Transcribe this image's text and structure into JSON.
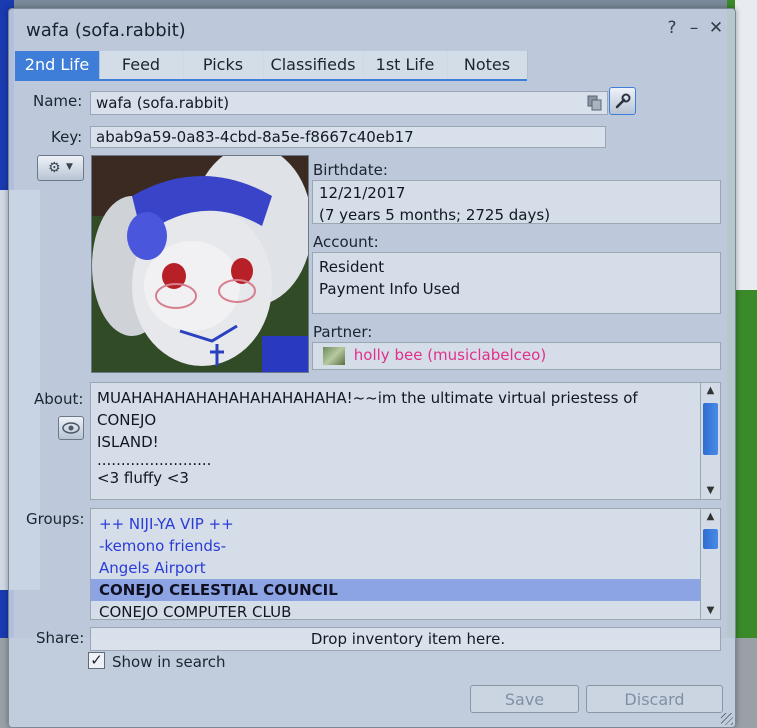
{
  "window": {
    "title": "wafa (sofa.rabbit)",
    "help_glyph": "?",
    "minimize_glyph": "–",
    "close_glyph": "✕"
  },
  "tabs": [
    {
      "label": "2nd Life",
      "active": true
    },
    {
      "label": "Feed"
    },
    {
      "label": "Picks"
    },
    {
      "label": "Classifieds"
    },
    {
      "label": "1st Life"
    },
    {
      "label": "Notes"
    }
  ],
  "profile": {
    "name_label": "Name:",
    "name_value": "wafa (sofa.rabbit)",
    "key_label": "Key:",
    "key_value": "abab9a59-0a83-4cbd-8a5e-f8667c40eb17",
    "birthdate_label": "Birthdate:",
    "birthdate_value": "12/21/2017",
    "birthdate_age": "(7 years 5 months; 2725 days)",
    "account_label": "Account:",
    "account_lines": [
      "Resident",
      "Payment Info Used"
    ],
    "partner_label": "Partner:",
    "partner_value": "holly bee (musiclabelceo)",
    "about_label": "About:",
    "about_lines": [
      "MUAHAHAHAHAHAHAHAHAHAHA!~~im the ultimate virtual priestess of CONEJO",
      "ISLAND!",
      "........................",
      "<3 fluffy <3"
    ],
    "groups_label": "Groups:",
    "groups": [
      {
        "name": "++ NIJI-YA VIP ++"
      },
      {
        "name": "-kemono friends-"
      },
      {
        "name": "Angels Airport"
      },
      {
        "name": "CONEJO CELESTIAL COUNCIL",
        "selected": true
      },
      {
        "name": "CONEJO COMPUTER CLUB"
      }
    ],
    "share_label": "Share:",
    "share_drop_text": "Drop inventory item here.",
    "show_in_search_label": "Show in search",
    "show_in_search_checked": true
  },
  "buttons": {
    "save": "Save",
    "discard": "Discard"
  },
  "colors": {
    "accent": "#3e7ed8",
    "partner_link": "#e0308a",
    "group_link": "#2a3cd8"
  },
  "icons": [
    "copy-icon",
    "wrench-icon",
    "gear-icon",
    "eye-icon"
  ]
}
